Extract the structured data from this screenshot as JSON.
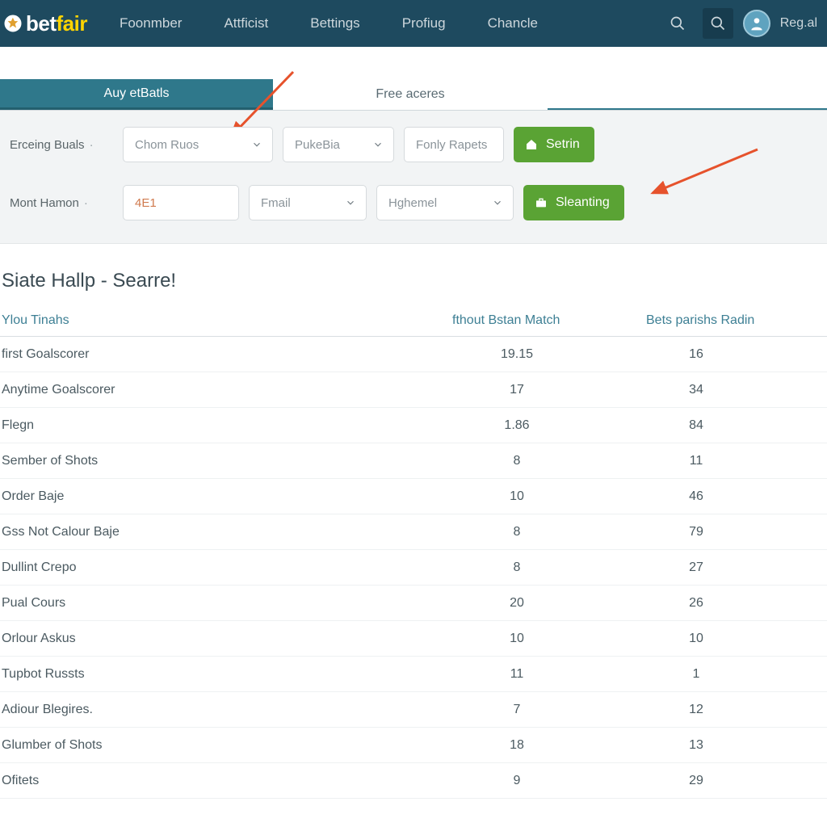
{
  "header": {
    "logo_bet": "bet",
    "logo_fair": "fair",
    "nav": [
      "Foonmber",
      "Attficist",
      "Bettings",
      "Profiug",
      "Chancle"
    ],
    "reg": "Reg.al"
  },
  "tabs": {
    "active": "Auy etBatls",
    "secondary": "Free aceres"
  },
  "filters": {
    "row1": {
      "label": "Erceing Buals",
      "sel1": "Chom Ruos",
      "sel2": "PukeBia",
      "sel3": "Fonly Rapets",
      "btn": "Setrin"
    },
    "row2": {
      "label": "Mont Hamon",
      "input": "4E1",
      "sel1": "Fmail",
      "sel2": "Hghemel",
      "btn": "Sleanting"
    }
  },
  "section_title": "Siate Hallp - Searre!",
  "table": {
    "headers": [
      "Ylou Tinahs",
      "fthout Bstan Match",
      "Bets parishs Radin"
    ],
    "rows": [
      {
        "name": "first Goalscorer",
        "c2": "19.15",
        "c3": "16"
      },
      {
        "name": "Anytime Goalscorer",
        "c2": "17",
        "c3": "34"
      },
      {
        "name": "Flegn",
        "c2": "1.86",
        "c3": "84"
      },
      {
        "name": "Sember of Shots",
        "c2": "8",
        "c3": "11"
      },
      {
        "name": "Order Baje",
        "c2": "10",
        "c3": "46"
      },
      {
        "name": "Gss Not Calour Baje",
        "c2": "8",
        "c3": "79"
      },
      {
        "name": "Dullint Crepo",
        "c2": "8",
        "c3": "27"
      },
      {
        "name": "Pual Cours",
        "c2": "20",
        "c3": "26"
      },
      {
        "name": "Orlour Askus",
        "c2": "10",
        "c3": "10"
      },
      {
        "name": "Tupbot Russts",
        "c2": "11",
        "c3": "1"
      },
      {
        "name": "Adiour Blegires.",
        "c2": "7",
        "c3": "12"
      },
      {
        "name": "Glumber of Shots",
        "c2": "18",
        "c3": "13"
      },
      {
        "name": "Ofitets",
        "c2": "9",
        "c3": "29"
      }
    ]
  }
}
